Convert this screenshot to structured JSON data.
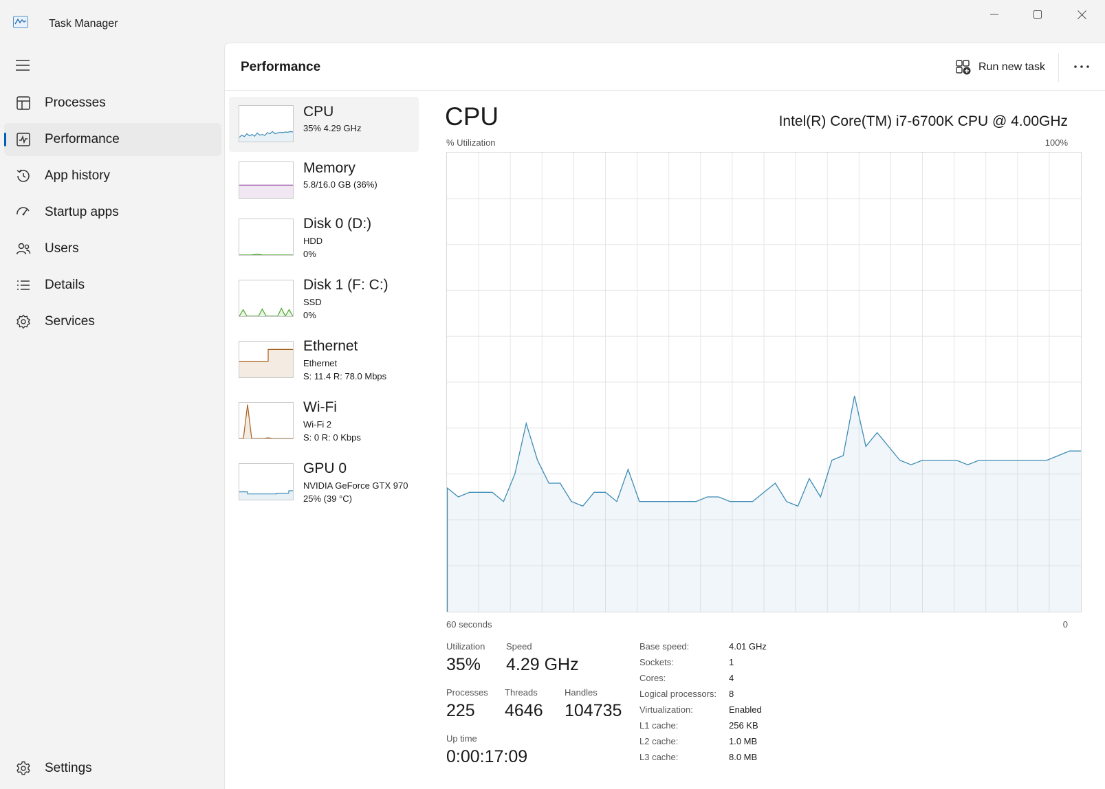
{
  "window": {
    "title": "Task Manager",
    "controls": [
      "minimize",
      "maximize",
      "close"
    ]
  },
  "nav": {
    "items": [
      {
        "label": "Processes",
        "icon": "processes-icon"
      },
      {
        "label": "Performance",
        "icon": "performance-icon",
        "active": true
      },
      {
        "label": "App history",
        "icon": "app-history-icon"
      },
      {
        "label": "Startup apps",
        "icon": "startup-apps-icon"
      },
      {
        "label": "Users",
        "icon": "users-icon"
      },
      {
        "label": "Details",
        "icon": "details-icon"
      },
      {
        "label": "Services",
        "icon": "services-icon"
      }
    ],
    "settings": {
      "label": "Settings",
      "icon": "gear-icon"
    }
  },
  "header": {
    "title": "Performance",
    "run_new_task": "Run new task"
  },
  "resources": [
    {
      "name": "CPU",
      "line1": "35%  4.29 GHz",
      "line2": "",
      "color": "#3c8bb5"
    },
    {
      "name": "Memory",
      "line1": "5.8/16.0 GB (36%)",
      "line2": "",
      "color": "#8b3a99"
    },
    {
      "name": "Disk 0 (D:)",
      "line1": "HDD",
      "line2": "0%",
      "color": "#4ca82c"
    },
    {
      "name": "Disk 1 (F: C:)",
      "line1": "SSD",
      "line2": "0%",
      "color": "#4ca82c"
    },
    {
      "name": "Ethernet",
      "line1": "Ethernet",
      "line2": "S: 11.4  R: 78.0 Mbps",
      "color": "#a7601c"
    },
    {
      "name": "Wi-Fi",
      "line1": "Wi-Fi 2",
      "line2": "S: 0  R: 0 Kbps",
      "color": "#a7601c"
    },
    {
      "name": "GPU 0",
      "line1": "NVIDIA GeForce GTX 970",
      "line2": "25%  (39 °C)",
      "color": "#3c8bb5"
    }
  ],
  "detail": {
    "title": "CPU",
    "model": "Intel(R) Core(TM) i7-6700K CPU @ 4.00GHz",
    "y_label": "% Utilization",
    "y_max_label": "100%",
    "x_left_label": "60 seconds",
    "x_right_label": "0"
  },
  "stats": {
    "utilization": {
      "label": "Utilization",
      "value": "35%"
    },
    "speed": {
      "label": "Speed",
      "value": "4.29 GHz"
    },
    "processes": {
      "label": "Processes",
      "value": "225"
    },
    "threads": {
      "label": "Threads",
      "value": "4646"
    },
    "handles": {
      "label": "Handles",
      "value": "104735"
    },
    "uptime": {
      "label": "Up time",
      "value": "0:00:17:09"
    }
  },
  "specs": [
    {
      "key": "Base speed:",
      "value": "4.01 GHz"
    },
    {
      "key": "Sockets:",
      "value": "1"
    },
    {
      "key": "Cores:",
      "value": "4"
    },
    {
      "key": "Logical processors:",
      "value": "8"
    },
    {
      "key": "Virtualization:",
      "value": "Enabled"
    },
    {
      "key": "L1 cache:",
      "value": "256 KB"
    },
    {
      "key": "L2 cache:",
      "value": "1.0 MB"
    },
    {
      "key": "L3 cache:",
      "value": "8.0 MB"
    }
  ],
  "chart_data": {
    "type": "area",
    "x_range": [
      60,
      0
    ],
    "ylim": [
      0,
      100
    ],
    "grid": true,
    "series": [
      {
        "color": "#3c8bb5",
        "values": [
          27,
          25,
          26,
          26,
          26,
          24,
          30,
          41,
          33,
          28,
          28,
          24,
          23,
          26,
          26,
          24,
          31,
          24,
          24,
          24,
          24,
          24,
          24,
          25,
          25,
          24,
          24,
          24,
          26,
          28,
          24,
          23,
          29,
          25,
          33,
          34,
          47,
          36,
          39,
          36,
          33,
          32,
          33,
          33,
          33,
          33,
          32,
          33,
          33,
          33,
          33,
          33,
          33,
          33,
          34,
          35,
          35
        ]
      }
    ]
  },
  "thumb_data": {
    "cpu": [
      12,
      18,
      14,
      22,
      16,
      20,
      15,
      24,
      18,
      20,
      17,
      25,
      22,
      28,
      22,
      24,
      26,
      25,
      27,
      26,
      28,
      27
    ],
    "memory": [
      36,
      36,
      36,
      36,
      36,
      36,
      36,
      36,
      36,
      36
    ],
    "disk0": [
      0,
      0,
      0,
      2,
      0,
      0,
      0,
      0,
      0,
      0
    ],
    "disk1": [
      0,
      18,
      0,
      0,
      0,
      0,
      20,
      0,
      0,
      0,
      0,
      22,
      0,
      18,
      0
    ],
    "ethernet": [
      45,
      45,
      45,
      45,
      45,
      45,
      45,
      78,
      78,
      78,
      78,
      78,
      78,
      78
    ],
    "wifi": [
      0,
      0,
      95,
      0,
      0,
      0,
      0,
      2,
      0,
      0,
      0,
      0,
      0,
      0
    ],
    "gpu": [
      22,
      22,
      16,
      16,
      16,
      16,
      16,
      16,
      16,
      18,
      18,
      18,
      25,
      25
    ]
  }
}
